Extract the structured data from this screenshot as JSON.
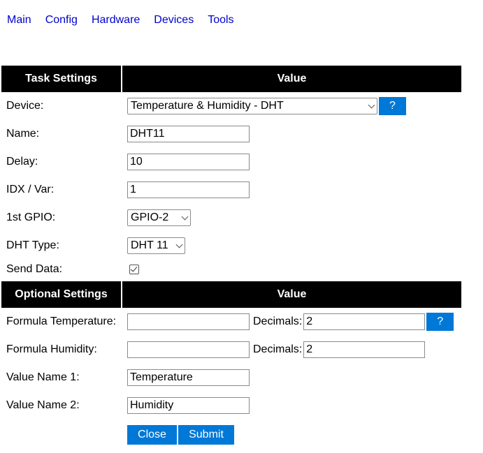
{
  "nav": {
    "items": [
      "Main",
      "Config",
      "Hardware",
      "Devices",
      "Tools"
    ]
  },
  "task_header": {
    "col1": "Task Settings",
    "col2": "Value"
  },
  "task": {
    "device_label": "Device:",
    "device_value": "Temperature & Humidity - DHT",
    "help_label": "?",
    "name_label": "Name:",
    "name_value": "DHT11",
    "delay_label": "Delay:",
    "delay_value": "10",
    "idx_label": "IDX / Var:",
    "idx_value": "1",
    "gpio_label": "1st GPIO:",
    "gpio_value": "GPIO-2",
    "dht_label": "DHT Type:",
    "dht_value": "DHT 11",
    "send_label": "Send Data:",
    "send_checked": true
  },
  "optional_header": {
    "col1": "Optional Settings",
    "col2": "Value"
  },
  "optional": {
    "formula_temp_label": "Formula Temperature:",
    "formula_temp_value": "",
    "decimals_label": "Decimals:",
    "decimals_temp_value": "2",
    "help_label": "?",
    "formula_hum_label": "Formula Humidity:",
    "formula_hum_value": "",
    "decimals_hum_value": "2",
    "value_name1_label": "Value Name 1:",
    "value_name1_value": "Temperature",
    "value_name2_label": "Value Name 2:",
    "value_name2_value": "Humidity"
  },
  "buttons": {
    "close": "Close",
    "submit": "Submit"
  }
}
